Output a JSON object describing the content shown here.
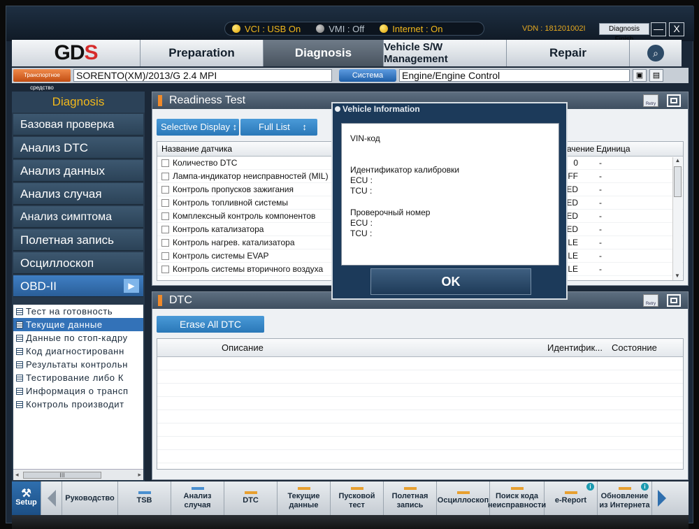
{
  "status": {
    "vci": "VCI : USB On",
    "vmi": "VMI : Off",
    "internet": "Internet : On",
    "vdn": "VDN : 181201002I",
    "diagnosis_finish": "Diagnosis Finish",
    "minimize": "—",
    "close": "X"
  },
  "nav": {
    "logo": "GDS",
    "tabs": [
      "Preparation",
      "Diagnosis",
      "Vehicle S/W Management",
      "Repair"
    ],
    "active_tab": "Diagnosis"
  },
  "vehicle": {
    "vehicle_btn": "Транспортное средство",
    "vehicle_value": "SORENTO(XM)/2013/G 2.4 MPI",
    "system_btn": "Система",
    "system_value": "Engine/Engine Control"
  },
  "sidebar": {
    "header": "Diagnosis",
    "items": [
      "Базовая проверка",
      "Анализ DTC",
      "Анализ данных",
      "Анализ случая",
      "Анализ симптома",
      "Полетная запись",
      "Осциллоскоп",
      "OBD-II"
    ],
    "sub_items": [
      "Тест на готовность",
      "Текущие данные",
      "Данные по стоп-кадру",
      "Код диагностированн",
      "Результаты контрольн",
      "Тестирование либо К",
      "Информация о трансп",
      "Контроль производит"
    ],
    "selected_sub": "Текущие данные",
    "scroll_label": "III"
  },
  "readiness": {
    "title": "Readiness Test",
    "selective_display": "Selective Display",
    "full_list": "Full List",
    "col_name": "Название датчика",
    "col_value": "ачение",
    "col_unit": "Единица",
    "rows": [
      {
        "name": "Количество DTC",
        "value": "0",
        "unit": "-"
      },
      {
        "name": "Лампа-индикатор неисправностей (MIL)",
        "value": "OFF",
        "unit": "-"
      },
      {
        "name": "Контроль пропусков зажигания",
        "value": "ETED",
        "unit": "-"
      },
      {
        "name": "Контроль топливной системы",
        "value": "ETED",
        "unit": "-"
      },
      {
        "name": "Комплексный контроль компонентов",
        "value": "ETED",
        "unit": "-"
      },
      {
        "name": "Контроль катализатора",
        "value": "ETED",
        "unit": "-"
      },
      {
        "name": "Контроль нагрев. катализатора",
        "value": "ABLE",
        "unit": "-"
      },
      {
        "name": "Контроль системы EVAP",
        "value": "ABLE",
        "unit": "-"
      },
      {
        "name": "Контроль системы вторичного воздуха",
        "value": "ABLE",
        "unit": "-"
      }
    ]
  },
  "dtc": {
    "title": "DTC",
    "erase_all": "Erase All DTC",
    "col_desc": "Описание",
    "col_id": "Идентифик...",
    "col_state": "Состояние"
  },
  "modal": {
    "title": "Vehicle Information",
    "vin_label": "VIN-код",
    "calib_label": "Идентификатор калибровки",
    "ecu1": "ECU :",
    "tcu1": "TCU :",
    "check_label": "Проверочный номер",
    "ecu2": "ECU :",
    "tcu2": "TCU :",
    "ok": "OK"
  },
  "toolbar": {
    "setup": "Setup",
    "items": [
      "Руководство",
      "TSB",
      "Анализ случая",
      "DTC",
      "Текущие данные",
      "Пусковой тест",
      "Полетная запись",
      "Осциллоскоп",
      "Поиск кода неисправности",
      "e-Report",
      "Обновление из Интернета"
    ]
  }
}
